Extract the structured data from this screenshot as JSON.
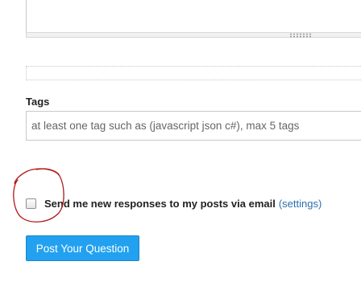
{
  "tags": {
    "label": "Tags",
    "placeholder": "at least one tag such as (javascript json c#), max 5 tags",
    "value": ""
  },
  "notify": {
    "label": "Send me new responses to my posts via email",
    "settings_link": "(settings)",
    "checked": false
  },
  "submit": {
    "label": "Post Your Question"
  },
  "colors": {
    "button": "#22a1f0",
    "link": "#2a6fb0",
    "annotation": "#b01818"
  }
}
